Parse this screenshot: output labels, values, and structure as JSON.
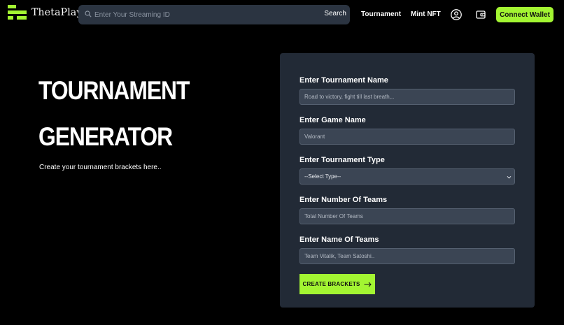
{
  "header": {
    "brand": "ThetaPlay",
    "search": {
      "placeholder": "Enter Your Streaming ID",
      "button_label": "Search"
    },
    "nav": {
      "tournament": "Tournament",
      "mint_nft": "Mint NFT"
    },
    "icons": [
      "user-icon",
      "wallet-icon"
    ],
    "connect_wallet_label": "Connect Wallet"
  },
  "hero": {
    "title_line1": "TOURNAMENT",
    "title_line2": "GENERATOR",
    "subtitle": "Create your tournament brackets here.."
  },
  "form": {
    "tournament_name": {
      "label": "Enter Tournament Name",
      "placeholder": "Road to victory, fight till last breath,.."
    },
    "game_name": {
      "label": "Enter Game Name",
      "placeholder": "Valorant"
    },
    "tournament_type": {
      "label": "Enter Tournament Type",
      "selected": "--Select Type--"
    },
    "number_of_teams": {
      "label": "Enter Number Of Teams",
      "placeholder": "Total Number Of Teams"
    },
    "name_of_teams": {
      "label": "Enter Name Of Teams",
      "placeholder": "Team Vitalik, Team Satoshi.."
    },
    "submit_label": "CREATE BRACKETS"
  },
  "colors": {
    "background": "#000000",
    "accent": "#a3f532",
    "card": "#222a36",
    "input": "#3b4554"
  }
}
